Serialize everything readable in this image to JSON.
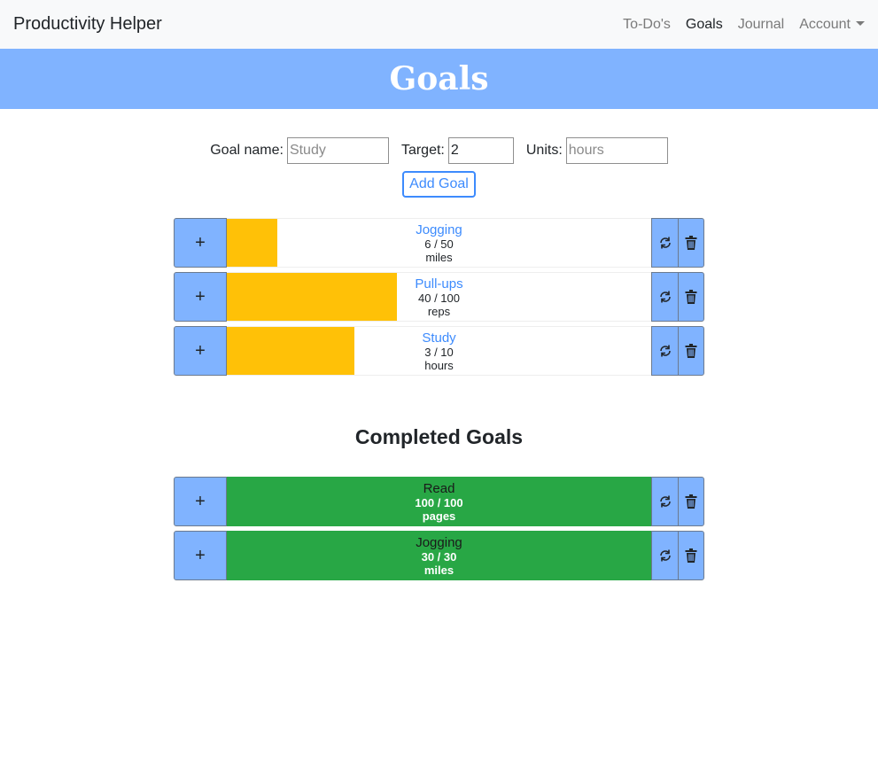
{
  "navbar": {
    "brand": "Productivity Helper",
    "links": [
      "To-Do's",
      "Goals",
      "Journal",
      "Account"
    ]
  },
  "banner": {
    "title": "Goals"
  },
  "form": {
    "goal_name_label": "Goal name:",
    "goal_name_placeholder": "Study",
    "target_label": "Target:",
    "target_value": "2",
    "units_label": "Units:",
    "units_placeholder": "hours",
    "add_button": "Add Goal"
  },
  "active_goals": [
    {
      "name": "Jogging",
      "progress": "6 / 50",
      "units": "miles",
      "fraction": 0.12
    },
    {
      "name": "Pull-ups",
      "progress": "40 / 100",
      "units": "reps",
      "fraction": 0.4
    },
    {
      "name": "Study",
      "progress": "3 / 10",
      "units": "hours",
      "fraction": 0.3
    }
  ],
  "completed_title": "Completed Goals",
  "completed_goals": [
    {
      "name": "Read",
      "progress": "100 / 100",
      "units": "pages",
      "fraction": 1.0
    },
    {
      "name": "Jogging",
      "progress": "30 / 30",
      "units": "miles",
      "fraction": 1.0
    }
  ],
  "row_buttons": {
    "increment": "+"
  },
  "colors": {
    "accent_blue": "#80b3ff",
    "progress_yellow": "#ffc107",
    "complete_green": "#28a745"
  }
}
